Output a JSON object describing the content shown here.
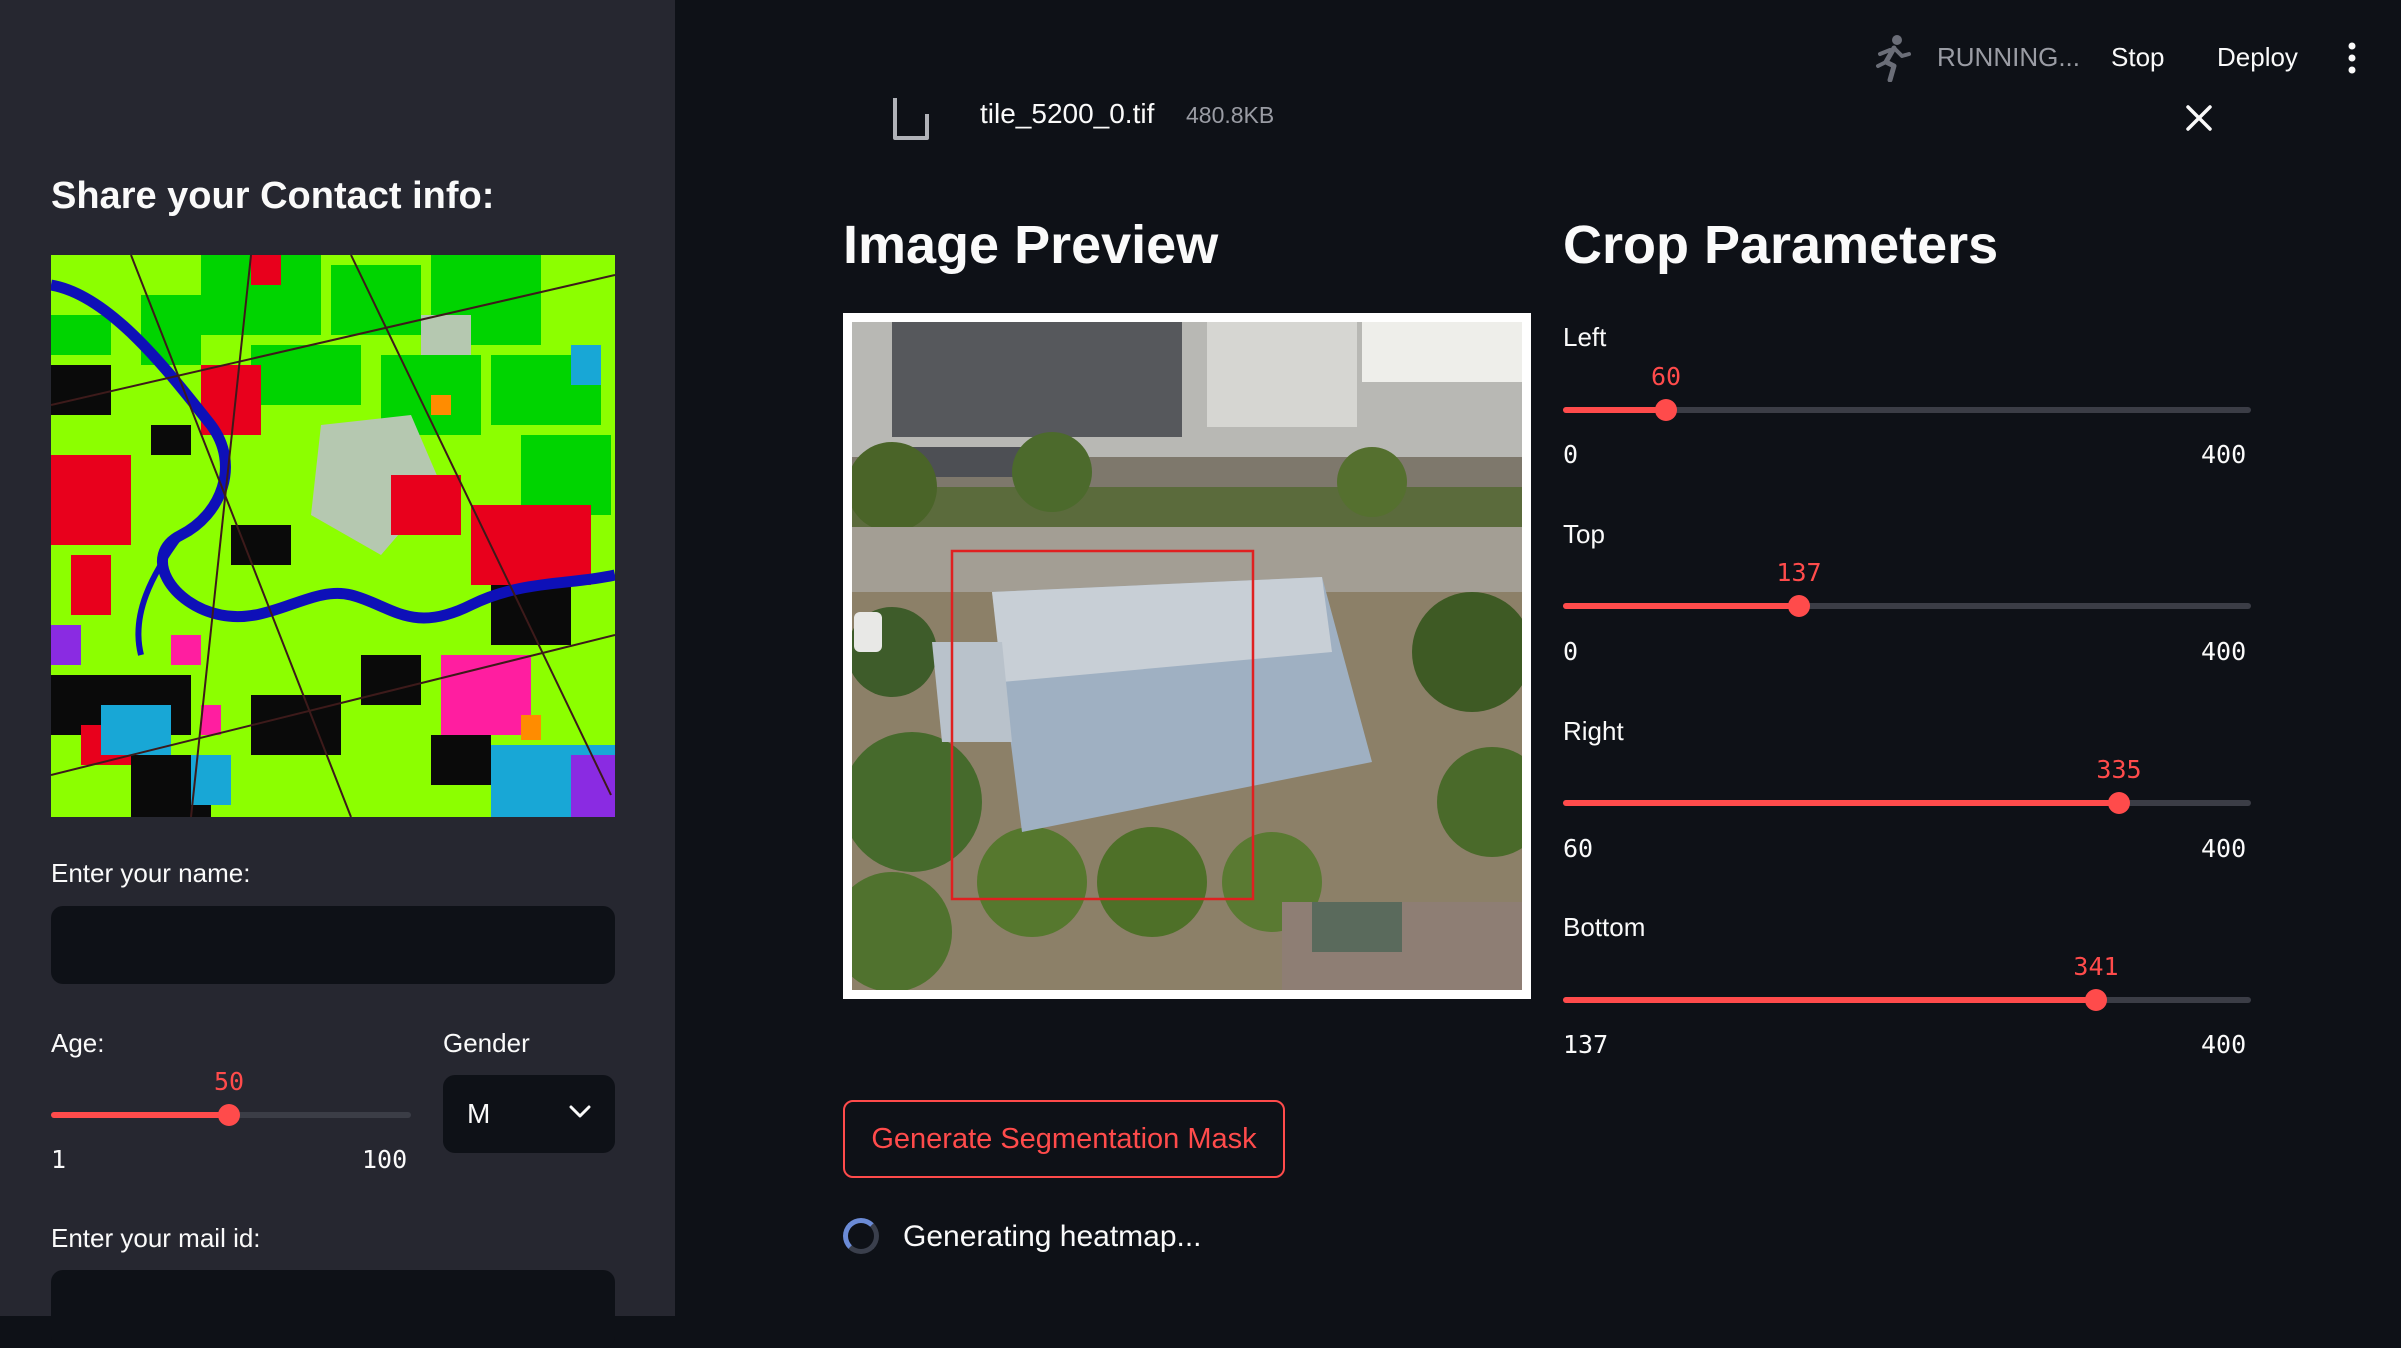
{
  "header": {
    "status": "RUNNING...",
    "stop_label": "Stop",
    "deploy_label": "Deploy"
  },
  "sidebar": {
    "heading": "Share your Contact info:",
    "name_label": "Enter your name:",
    "name_value": "",
    "age": {
      "label": "Age:",
      "value": "50",
      "min": "1",
      "max": "100",
      "fraction": 0.495
    },
    "gender": {
      "label": "Gender",
      "selected": "M"
    },
    "mail_label": "Enter your mail id:",
    "mail_value": ""
  },
  "file": {
    "name": "tile_5200_0.tif",
    "size": "480.8KB"
  },
  "preview": {
    "heading": "Image Preview"
  },
  "crop": {
    "heading": "Crop Parameters",
    "left": {
      "label": "Left",
      "value": "60",
      "min": "0",
      "max": "400",
      "fraction": 0.15
    },
    "top": {
      "label": "Top",
      "value": "137",
      "min": "0",
      "max": "400",
      "fraction": 0.3425
    },
    "right": {
      "label": "Right",
      "value": "335",
      "min": "60",
      "max": "400",
      "fraction": 0.8088
    },
    "bottom": {
      "label": "Bottom",
      "value": "341",
      "min": "137",
      "max": "400",
      "fraction": 0.7757
    }
  },
  "actions": {
    "generate_label": "Generate Segmentation Mask"
  },
  "status_text": "Generating heatmap...",
  "colors": {
    "accent": "#ff4b4b",
    "background": "#0e1117",
    "sidebar": "#262730"
  }
}
